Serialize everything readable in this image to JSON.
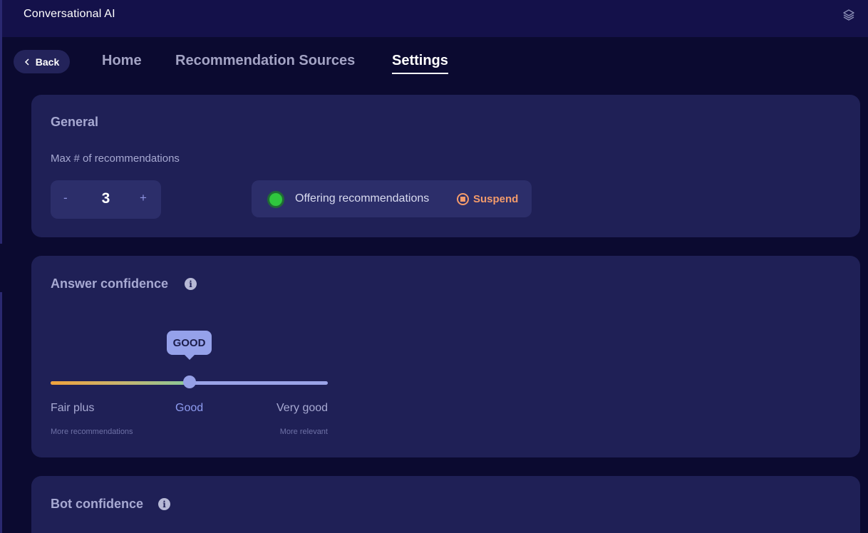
{
  "app": {
    "title": "Conversational AI"
  },
  "nav": {
    "back_label": "Back",
    "tabs": [
      {
        "label": "Home",
        "active": false
      },
      {
        "label": "Recommendation Sources",
        "active": false
      },
      {
        "label": "Settings",
        "active": true
      }
    ]
  },
  "general": {
    "title": "General",
    "max_label": "Max # of recommendations",
    "stepper": {
      "minus": "-",
      "value": "3",
      "plus": "+"
    },
    "status": {
      "text": "Offering recommendations",
      "state_color": "#2fc73e",
      "action_label": "Suspend",
      "action_color": "#f39b6b"
    }
  },
  "answer_confidence": {
    "title": "Answer confidence",
    "info_icon": "i",
    "slider": {
      "tooltip": "GOOD",
      "selected_index": 1,
      "levels": [
        "Fair plus",
        "Good",
        "Very good"
      ],
      "left_hint": "More recommendations",
      "right_hint": "More relevant"
    }
  },
  "bot_confidence": {
    "title": "Bot confidence",
    "info_icon": "i"
  },
  "icons": {
    "layers": "layers-icon",
    "back": "chevron-left-icon",
    "info": "info-icon",
    "suspend": "stop-circle-icon"
  }
}
